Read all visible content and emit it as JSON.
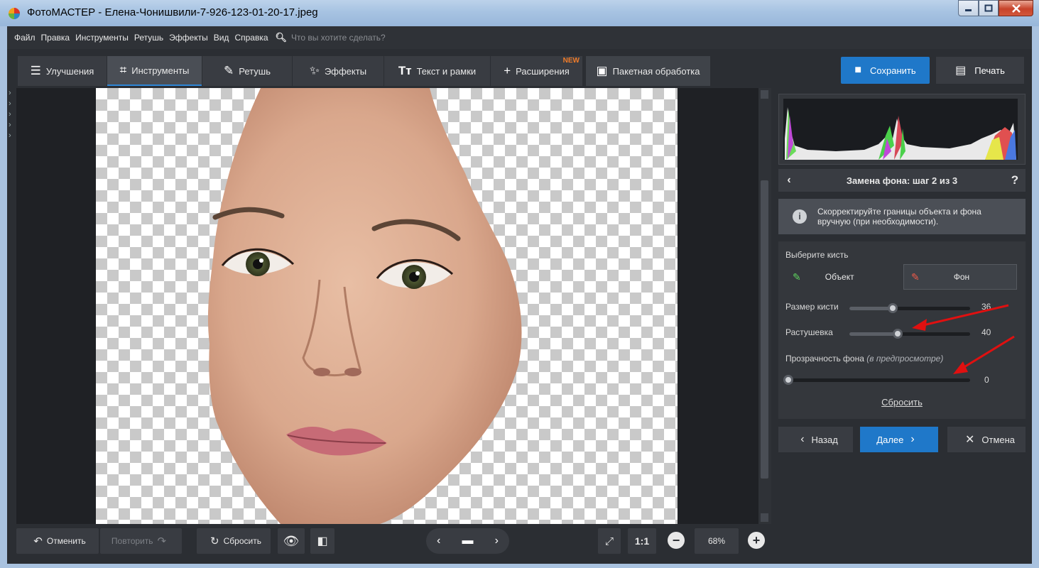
{
  "window": {
    "title": "ФотоМАСТЕР - Елена-Чонишвили-7-926-123-01-20-17.jpeg",
    "app_icon": "fotomaster-logo-icon"
  },
  "menu": {
    "items": [
      "Файл",
      "Правка",
      "Инструменты",
      "Ретушь",
      "Эффекты",
      "Вид",
      "Справка"
    ],
    "search_placeholder": "Что вы хотите сделать?"
  },
  "tabs": [
    {
      "label": "Улучшения",
      "icon": "sliders-icon"
    },
    {
      "label": "Инструменты",
      "icon": "crop-icon",
      "active": true
    },
    {
      "label": "Ретушь",
      "icon": "brush-icon"
    },
    {
      "label": "Эффекты",
      "icon": "magic-wand-icon"
    },
    {
      "label": "Текст и рамки",
      "icon": "text-icon"
    },
    {
      "label": "Расширения",
      "icon": "plus-icon",
      "badge": "NEW"
    },
    {
      "label": "Пакетная обработка",
      "icon": "batch-images-icon"
    }
  ],
  "actions": {
    "save": "Сохранить",
    "print": "Печать"
  },
  "panel": {
    "step_title": "Замена фона: шаг 2 из 3",
    "help": "?",
    "info": "Скорректируйте границы объекта и фона вручную (при необходимости).",
    "choose_brush": "Выберите кисть",
    "brush_object": "Объект",
    "brush_background": "Фон",
    "brush_size_label": "Размер кисти",
    "brush_size_value": "36",
    "brush_size_fraction": 0.36,
    "feather_label": "Растушевка",
    "feather_value": "40",
    "feather_fraction": 0.4,
    "transparency_label": "Прозрачность фона",
    "transparency_note": "(в предпросмотре)",
    "transparency_value": "0",
    "transparency_fraction": 0,
    "reset": "Сбросить",
    "back": "Назад",
    "next": "Далее",
    "cancel": "Отмена"
  },
  "bottom": {
    "undo": "Отменить",
    "redo": "Повторить",
    "reset": "Сбросить",
    "ratio": "1:1",
    "zoom": "68%"
  },
  "colors": {
    "accent": "#1f78c9",
    "badge": "#f07c2a",
    "annotation_arrow": "#e01010"
  }
}
